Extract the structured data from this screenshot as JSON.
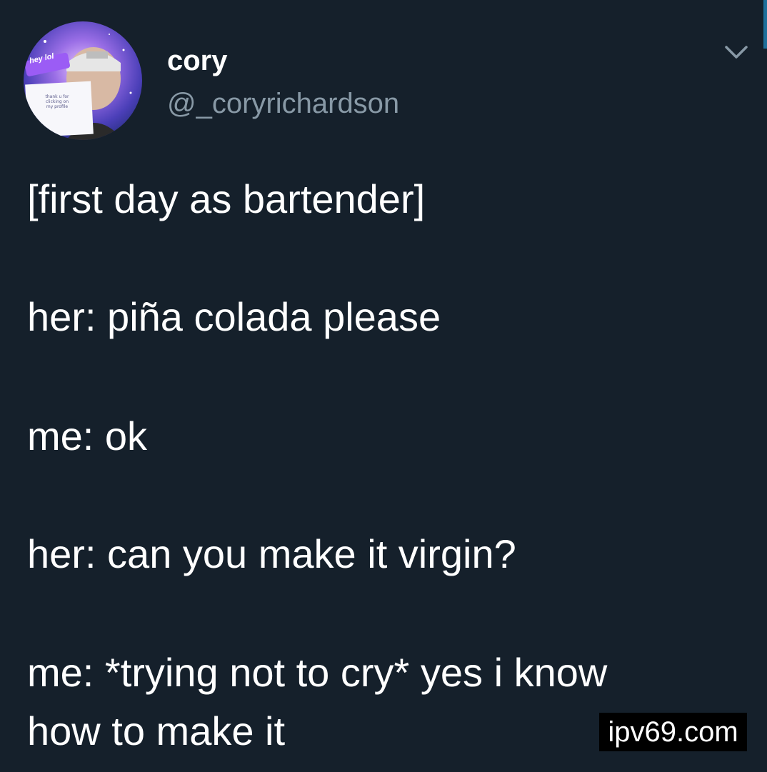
{
  "tweet": {
    "author": {
      "display_name": "cory",
      "handle": "@_coryrichardson",
      "avatar": {
        "sticker_text": "hey lol",
        "note_text": "thank u for\nclicking on\nmy profile"
      }
    },
    "menu_icon": "chevron-down-icon",
    "lines": [
      "[first day as bartender]",
      "her: piña colada please",
      "me: ok",
      "her: can you make it virgin?",
      "me: *trying not to cry* yes i know",
      "how to make it"
    ]
  },
  "watermark": {
    "text": "ipv69.com"
  },
  "colors": {
    "background": "#15202b",
    "text": "#ffffff",
    "secondary_text": "#8899a6",
    "watermark_bg": "#000000"
  }
}
